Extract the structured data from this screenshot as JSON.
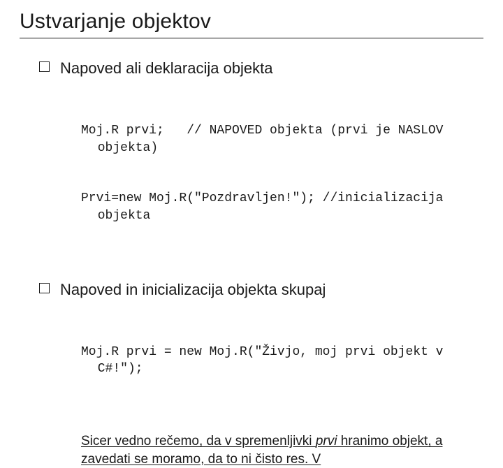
{
  "title": "Ustvarjanje objektov",
  "bullets": [
    {
      "heading": "Napoved ali deklaracija objekta",
      "code_lines": [
        "Moj.R prvi;   // NAPOVED objekta (prvi je NASLOV objekta)",
        "Prvi=new Moj.R(\"Pozdravljen!\"); //inicializacija objekta"
      ]
    },
    {
      "heading": "Napoved in inicializacija objekta skupaj",
      "code_lines": [
        "Moj.R prvi = new Moj.R(\"Živjo, moj prvi objekt v C#!\");"
      ]
    }
  ],
  "note_pre": "Sicer vedno rečemo, da v spremenljivki ",
  "note_em": "prvi",
  "note_post": "  hranimo objekt, a zavedati se moramo, da to ni čisto res. V"
}
